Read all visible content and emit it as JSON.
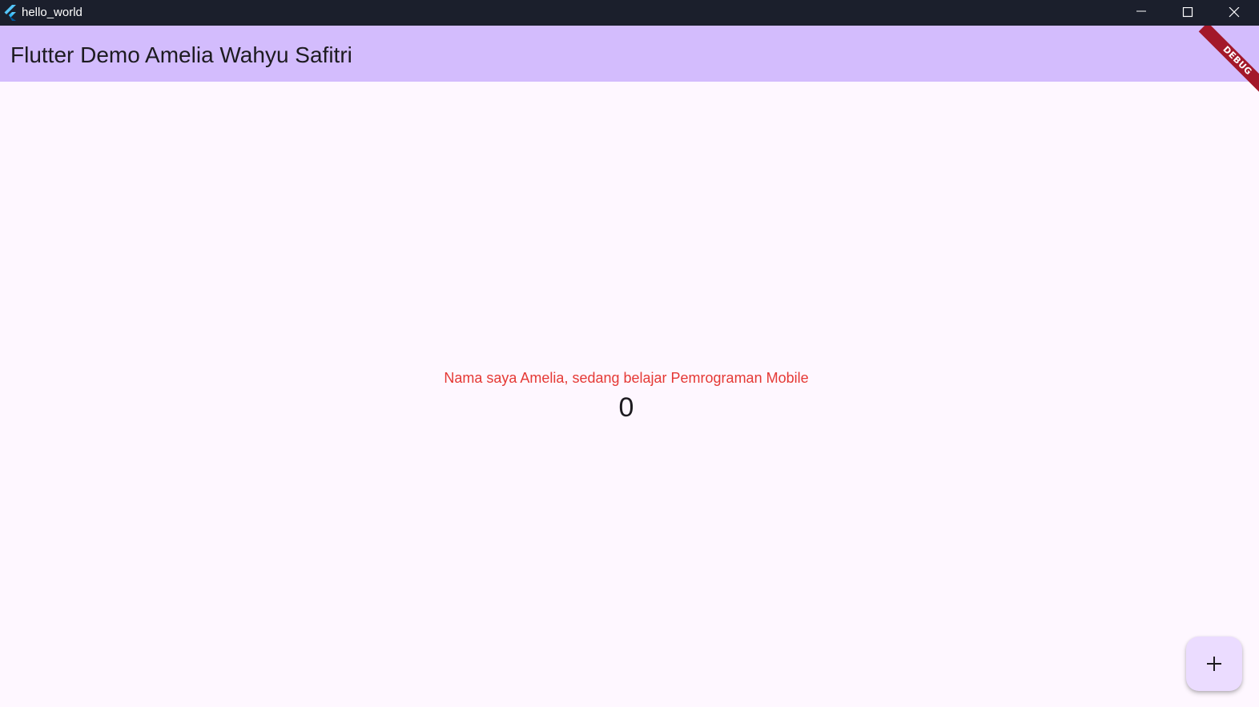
{
  "window": {
    "title": "hello_world",
    "icon": "flutter-logo-icon",
    "controls": [
      "minimize-icon",
      "maximize-icon",
      "close-icon"
    ]
  },
  "appbar": {
    "title": "Flutter Demo Amelia Wahyu Safitri",
    "background": "#d3bcfd"
  },
  "debug_banner": {
    "label": "DEBUG",
    "color": "#a3182a"
  },
  "main": {
    "message": "Nama saya Amelia, sedang belajar Pemrograman Mobile",
    "message_color": "#e53935",
    "counter": "0"
  },
  "fab": {
    "icon": "plus-icon",
    "background": "#ebdcff"
  }
}
